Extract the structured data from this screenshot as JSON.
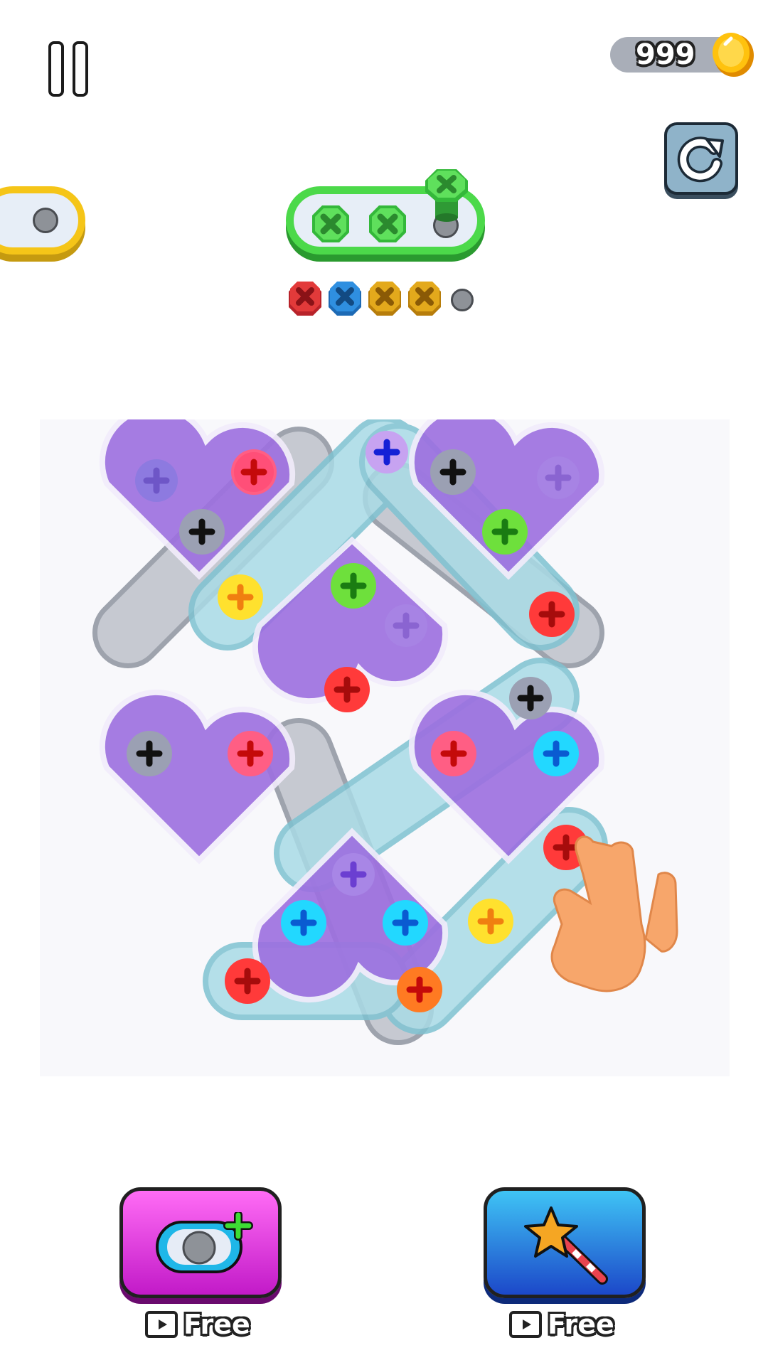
{
  "top_bar": {
    "coin_count": "999",
    "pause_icon": "pause-icon",
    "coin_icon": "gold-coin-icon",
    "restart_icon": "restart-icon"
  },
  "tray": {
    "active_color": "#4cd94a",
    "queued_screw_colors": [
      "#e23a3a",
      "#2f8fe0",
      "#e3a91c",
      "#e3a91c"
    ]
  },
  "board": {
    "hint_icon": "pointing-hand-icon"
  },
  "bottom": {
    "add_hole_button_icon": "add-hole-icon",
    "add_hole_label": "Free",
    "wand_button_icon": "magic-wand-icon",
    "wand_label": "Free",
    "video_icon": "video-ad-icon"
  },
  "colors": {
    "purple": "#9d6fe0",
    "teal": "#9fd3df",
    "grey": "#b9bdc7"
  }
}
